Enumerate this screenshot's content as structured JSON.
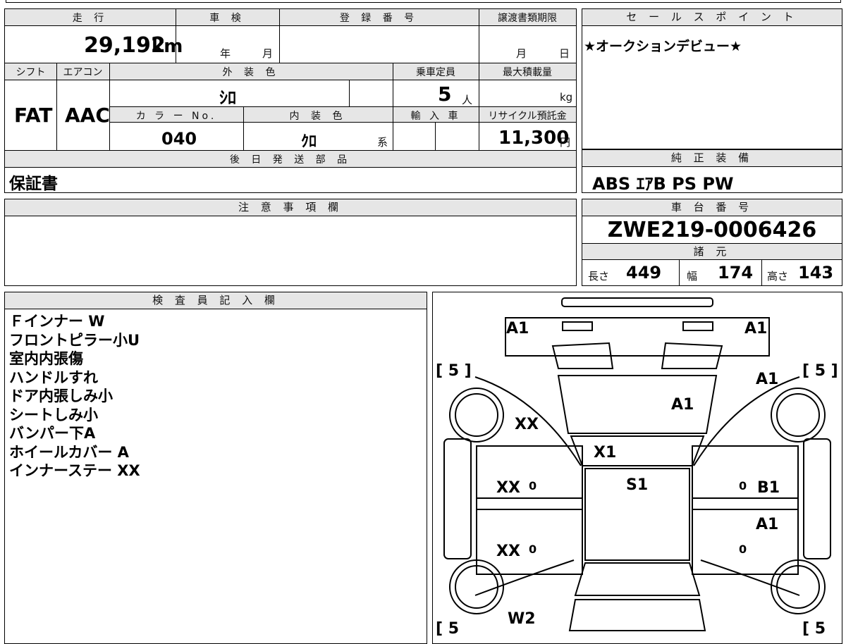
{
  "top_info": {
    "mileage_label": "走 行",
    "mileage_value": "29,192",
    "mileage_unit": "km",
    "inspection_label": "車 検",
    "inspection_year_unit": "年",
    "inspection_month_unit": "月",
    "registration_label": "登 録 番 号",
    "deadline_label": "譲渡書類期限",
    "deadline_month_unit": "月",
    "deadline_day_unit": "日",
    "shift_label": "シフト",
    "shift_value": "FAT",
    "aircon_label": "エアコン",
    "aircon_value": "AAC",
    "exterior_color_label": "外 装 色",
    "exterior_color_value": "ｼﾛ",
    "capacity_label": "乗車定員",
    "capacity_value": "5",
    "capacity_unit": "人",
    "max_load_label": "最大積載量",
    "max_load_unit": "kg",
    "color_no_label": "カ ラ ー No.",
    "color_no_value": "040",
    "interior_color_label": "内 装 色",
    "interior_color_value": "ｸﾛ",
    "interior_color_suffix": "系",
    "import_label": "輸 入 車",
    "recycle_label": "リサイクル預託金",
    "recycle_value": "11,300",
    "recycle_unit": "円",
    "later_parts_label": "後 日 発 送 部 品",
    "later_parts_value": "保証書"
  },
  "sales_point": {
    "label": "セ ー ル ス ポ イ ン ト",
    "text": "★オークションデビュー★"
  },
  "equipment": {
    "label": "純 正 装 備",
    "value": "ABS ｴｱB PS PW"
  },
  "caution": {
    "label": "注 意 事 項 欄"
  },
  "chassis": {
    "label": "車 台 番 号",
    "value": "ZWE219-0006426"
  },
  "specs": {
    "label": "諸 元",
    "length_label": "長さ",
    "length_value": "449",
    "width_label": "幅",
    "width_value": "174",
    "height_label": "高さ",
    "height_value": "143"
  },
  "inspector": {
    "label": "検 査 員 記 入 欄",
    "notes": [
      "Ｆインナー W",
      "フロントピラー小U",
      "室内内張傷",
      "ハンドルすれ",
      "ドア内張しみ小",
      "シートしみ小",
      "バンパー下A",
      "ホイールカバー A",
      "インナーステー XX"
    ]
  },
  "car_diagram": {
    "front_left_bumper": "A1",
    "front_right_bumper": "A1",
    "tire_front_left": "[ 5 ]",
    "tire_front_right": "[ 5 ]",
    "tire_rear_left": "[ 5",
    "tire_rear_right": "[ 5",
    "right_fender": "A1",
    "hood": "A1",
    "left_fender": "XX",
    "windshield": "X1",
    "roof": "S1",
    "left_front_door": "XX",
    "left_rear_door": "XX",
    "right_front_door": "B1",
    "right_rear_door": "A1",
    "rear_left": "W2",
    "door_mark_lf": "0",
    "door_mark_lr": "0",
    "door_mark_rf": "0",
    "door_mark_rr": "0"
  }
}
